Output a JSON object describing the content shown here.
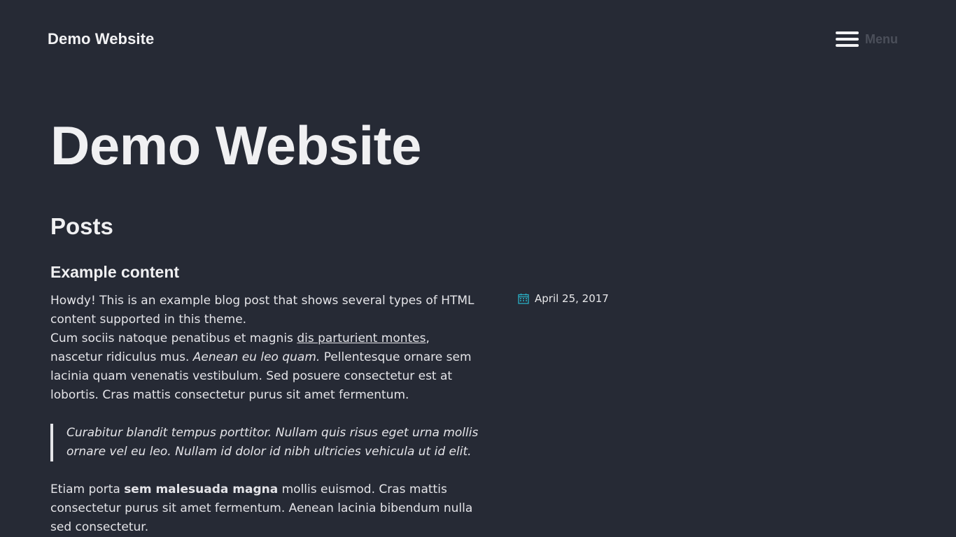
{
  "header": {
    "brand": "Demo Website",
    "menu_label": "Menu"
  },
  "hero": {
    "title": "Demo Website"
  },
  "section": {
    "title": "Posts"
  },
  "post": {
    "title": "Example content",
    "date": "April 25, 2017",
    "paragraph1": {
      "line1": "Howdy! This is an example blog post that shows several types of HTML content supported in this theme.",
      "text_a": "Cum sociis natoque penatibus et magnis ",
      "link": "dis parturient montes",
      "text_b": ", nascetur ridiculus mus. ",
      "italic": "Aenean eu leo quam.",
      "text_c": " Pellentesque ornare sem lacinia quam venenatis vestibulum. Sed posuere consectetur est at lobortis. Cras mattis consectetur purus sit amet fermentum."
    },
    "blockquote": "Curabitur blandit tempus porttitor. Nullam quis risus eget urna mollis ornare vel eu leo. Nullam id dolor id nibh ultricies vehicula ut id elit.",
    "paragraph2": {
      "text_a": "Etiam porta ",
      "bold": "sem malesuada magna",
      "text_b": " mollis euismod. Cras mattis consectetur purus sit amet fermentum. Aenean lacinia bibendum nulla sed consectetur."
    }
  },
  "colors": {
    "background": "#262a35",
    "text": "#e8e8ea",
    "muted": "#4b4f5a",
    "calendar_icon": "#2ab0c5"
  },
  "icons": {
    "menu": "hamburger-icon",
    "date": "calendar-icon"
  }
}
